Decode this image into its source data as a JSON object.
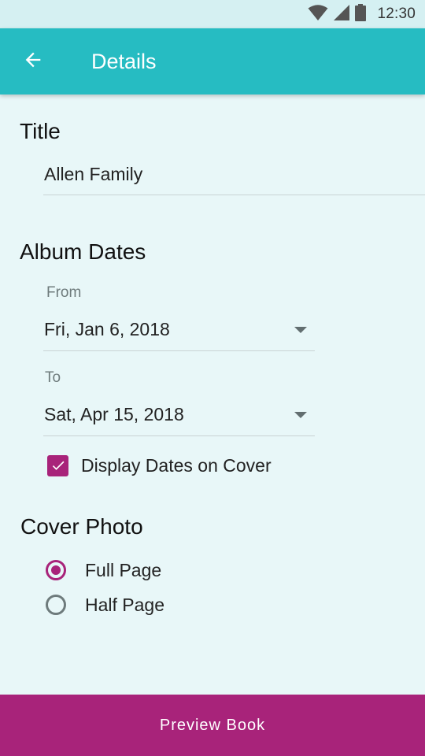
{
  "status_bar": {
    "time": "12:30",
    "icons": [
      "wifi-icon",
      "cell-signal-icon",
      "battery-icon"
    ]
  },
  "app_bar": {
    "title": "Details",
    "back_icon": "arrow-back-icon",
    "color": "#26BCC2"
  },
  "title_section": {
    "heading": "Title",
    "value": "Allen Family"
  },
  "album_dates": {
    "heading": "Album Dates",
    "from_label": "From",
    "from_value": "Fri, Jan 6, 2018",
    "to_label": "To",
    "to_value": "Sat, Apr 15, 2018",
    "display_on_cover_label": "Display Dates on Cover",
    "display_on_cover_checked": true
  },
  "cover_photo": {
    "heading": "Cover Photo",
    "options": [
      {
        "label": "Full Page",
        "selected": true
      },
      {
        "label": "Half Page",
        "selected": false
      }
    ]
  },
  "footer": {
    "button_label": "Preview Book",
    "color": "#A8237A"
  }
}
